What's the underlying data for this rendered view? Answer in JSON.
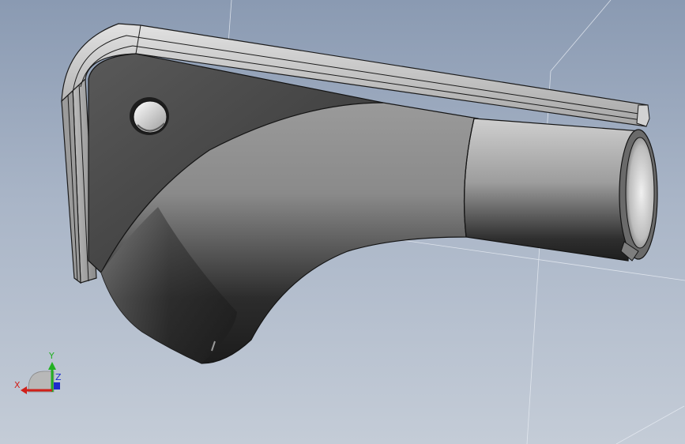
{
  "viewport": {
    "background_top": "#8a9ab2",
    "background_bottom": "#c4ccd7"
  },
  "part": {
    "body_color": "#4a4a4a",
    "highlight_color": "#b8b8b8",
    "edge_color": "#111111"
  },
  "triad": {
    "x_label": "X",
    "y_label": "Y",
    "z_label": "Z",
    "x_color": "#d0201a",
    "y_color": "#22b022",
    "z_color": "#1e2ccc"
  }
}
